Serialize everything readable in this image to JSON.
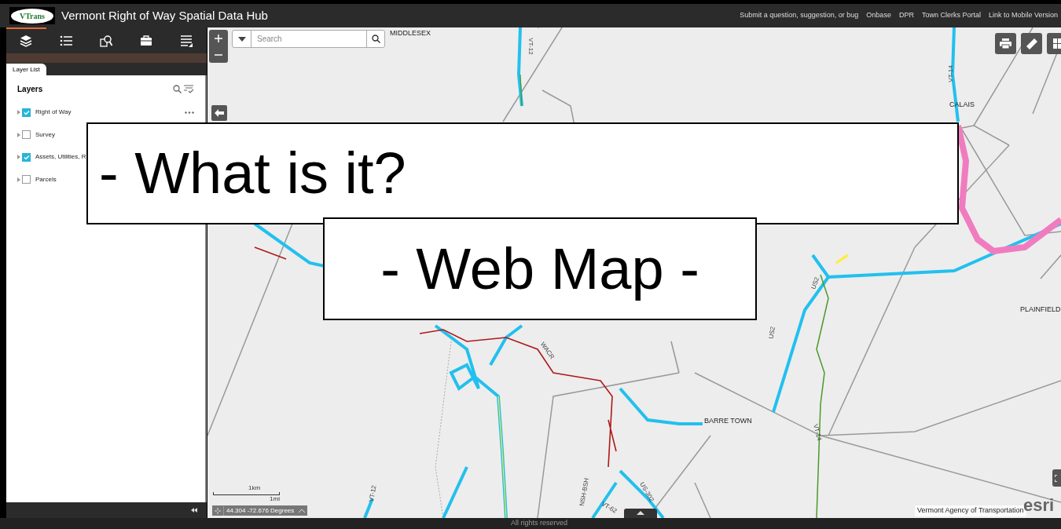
{
  "header": {
    "logo_text": "VTrans",
    "title": "Vermont Right of Way Spatial Data Hub",
    "links": [
      "Submit a question, suggestion, or bug",
      "Onbase",
      "DPR",
      "Town Clerks Portal",
      "Link to Mobile Version"
    ]
  },
  "sidebar": {
    "tools": [
      {
        "kind": "layers",
        "selected": true
      },
      {
        "kind": "legend",
        "selected": false
      },
      {
        "kind": "query",
        "selected": false
      },
      {
        "kind": "toolbox",
        "selected": false
      },
      {
        "kind": "list",
        "selected": false
      }
    ],
    "tab": "Layer List",
    "heading": "Layers",
    "layers": [
      {
        "label": "Right of Way",
        "checked": true
      },
      {
        "label": "Survey",
        "checked": false
      },
      {
        "label": "Assets, Utilities, R",
        "checked": true
      },
      {
        "label": "Parcels",
        "checked": false
      }
    ]
  },
  "map": {
    "search": {
      "placeholder": "Search"
    },
    "place_labels": [
      "MIDDLESEX",
      "CALAIS",
      "PLAINFIELD",
      "BARRE TOWN"
    ],
    "road_labels": [
      "VT-12",
      "VT-14",
      "US2",
      "US2",
      "WACR",
      "VT-14",
      "VT-12",
      "NSH-BSH",
      "US-302",
      "VT-62"
    ],
    "scale": {
      "top": "1km",
      "bottom": "1mi"
    },
    "coordinates": "44.304 -72.676 Degrees",
    "attribution": "Vermont Agency of Transportation",
    "esri": "esri"
  },
  "footer": "All rights reserved",
  "overlays": [
    "- What is it?",
    "- Web Map -"
  ]
}
